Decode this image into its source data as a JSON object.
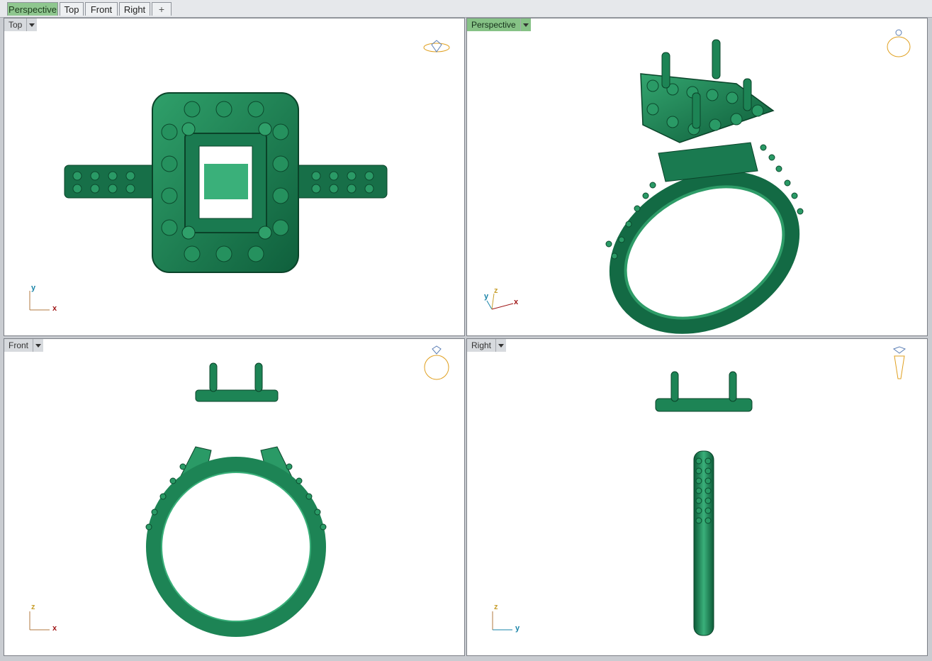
{
  "tabs": [
    {
      "label": "Perspective",
      "active": true
    },
    {
      "label": "Top",
      "active": false
    },
    {
      "label": "Front",
      "active": false
    },
    {
      "label": "Right",
      "active": false
    }
  ],
  "add_tab_icon": "plus-icon",
  "viewports": {
    "top": {
      "title": "Top",
      "axes": {
        "a": "y",
        "b": "x"
      }
    },
    "perspective": {
      "title": "Perspective",
      "axes": {
        "a": "y",
        "b": "z",
        "c": "x"
      }
    },
    "front": {
      "title": "Front",
      "axes": {
        "a": "z",
        "b": "x"
      }
    },
    "right": {
      "title": "Right",
      "axes": {
        "a": "z",
        "b": "y"
      }
    }
  },
  "colors": {
    "model": "#1f8a5c",
    "model_dark": "#0e5a39",
    "model_light": "#49b384",
    "active_tab": "#8fc78f",
    "axis_x": "#a01818",
    "axis_y": "#1a84a8",
    "axis_z": "#c8a030",
    "nav_icon": "#e0a020"
  }
}
